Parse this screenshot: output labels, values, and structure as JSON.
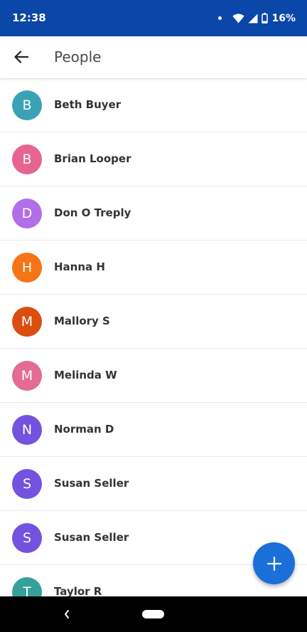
{
  "status_bar": {
    "time": "12:38",
    "battery": "16%"
  },
  "app_bar": {
    "title": "People"
  },
  "people": [
    {
      "initial": "B",
      "name": "Beth Buyer",
      "color": "#39a3b5"
    },
    {
      "initial": "B",
      "name": "Brian Looper",
      "color": "#e7648f"
    },
    {
      "initial": "D",
      "name": "Don O Treply",
      "color": "#b26ee6"
    },
    {
      "initial": "H",
      "name": "Hanna H",
      "color": "#f57416"
    },
    {
      "initial": "M",
      "name": "Mallory S",
      "color": "#db4d10"
    },
    {
      "initial": "M",
      "name": "Melinda W",
      "color": "#e46b93"
    },
    {
      "initial": "N",
      "name": "Norman D",
      "color": "#7352df"
    },
    {
      "initial": "S",
      "name": "Susan Seller",
      "color": "#7352df"
    },
    {
      "initial": "S",
      "name": "Susan Seller",
      "color": "#7352df"
    },
    {
      "initial": "T",
      "name": "Taylor R",
      "color": "#35a09a"
    }
  ],
  "icons": {
    "back": "arrow-left-icon",
    "fab": "plus-icon",
    "nav_back": "chevron-left-icon",
    "status": [
      "wifi-icon",
      "signal-icon",
      "battery-icon"
    ]
  },
  "colors": {
    "status_bar": "#0a47a8",
    "fab": "#1a6fd8"
  }
}
